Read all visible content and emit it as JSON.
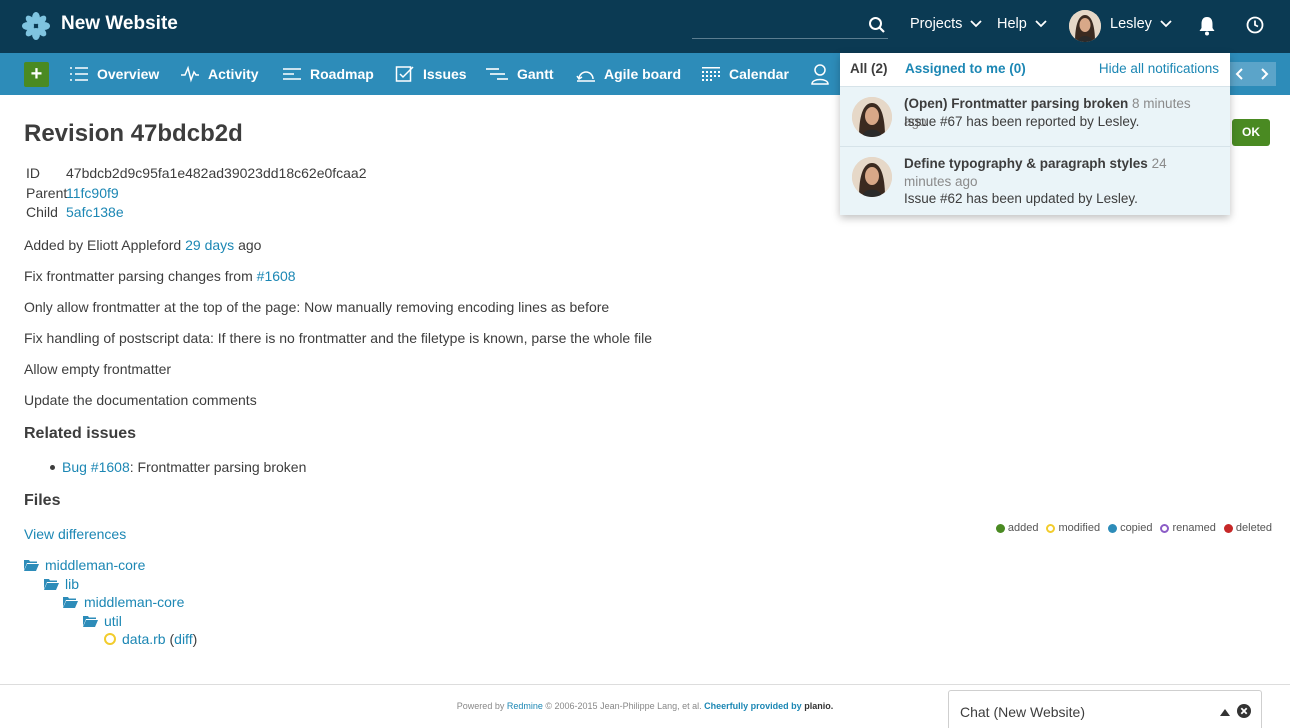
{
  "header": {
    "site_title": "New Website",
    "search_placeholder": "",
    "projects_label": "Projects",
    "help_label": "Help",
    "user_name": "Lesley"
  },
  "menu": {
    "add_label": "+",
    "items": [
      {
        "label": "Overview",
        "icon": "list-icon"
      },
      {
        "label": "Activity",
        "icon": "activity-icon"
      },
      {
        "label": "Roadmap",
        "icon": "roadmap-icon"
      },
      {
        "label": "Issues",
        "icon": "checkbox-icon"
      },
      {
        "label": "Gantt",
        "icon": "gantt-icon"
      },
      {
        "label": "Agile board",
        "icon": "agile-icon"
      },
      {
        "label": "Calendar",
        "icon": "calendar-icon"
      }
    ]
  },
  "revision": {
    "title": "Revision 47bdcb2d",
    "ok_label": "OK",
    "id_label": "ID",
    "id_value": "47bdcb2d9c95fa1e482ad39023dd18c62e0fcaa2",
    "parent_label": "Parent",
    "parent_value": "11fc90f9",
    "child_label": "Child",
    "child_value": "5afc138e",
    "added_by_prefix": "Added by Eliott Appleford",
    "added_by_link": "29 days",
    "added_by_suffix": "ago",
    "message_line1_prefix": "Fix frontmatter parsing changes from",
    "message_line1_link": "#1608",
    "message_line2": "Only allow frontmatter at the top of the page: Now manually removing encoding lines as before",
    "message_line3": "Fix handling of postscript data: If there is no frontmatter and the filetype is known, parse the whole file",
    "message_line4": "Allow empty frontmatter",
    "message_line5": "Update the documentation comments"
  },
  "related": {
    "heading": "Related issues",
    "issue_link": "Bug #1608",
    "issue_text": ": Frontmatter parsing broken"
  },
  "files": {
    "heading": "Files",
    "view_diff": "View differences",
    "legend": [
      {
        "label": "added",
        "color": "#4a8a22"
      },
      {
        "label": "modified",
        "color": "#f2cc2c"
      },
      {
        "label": "copied",
        "color": "#2d8cb9"
      },
      {
        "label": "renamed",
        "color": "#8b5cc6"
      },
      {
        "label": "deleted",
        "color": "#c62828"
      }
    ],
    "tree": [
      "middleman-core",
      "lib",
      "middleman-core",
      "util"
    ],
    "file_name": "data.rb",
    "diff_open": " (",
    "diff_link": "diff",
    "diff_close": ")"
  },
  "footer": {
    "powered_prefix": "Powered by",
    "redmine": "Redmine",
    "copyright": "© 2006-2015 Jean-Philippe Lang, et al.",
    "provided": "Cheerfully provided by",
    "brand": "planio."
  },
  "chat": {
    "title": "Chat (New Website)"
  },
  "notifications": {
    "tab_all": "All (2)",
    "tab_assigned": "Assigned to me (0)",
    "hide_all": "Hide all notifications",
    "items": [
      {
        "title": "(Open) Frontmatter parsing broken",
        "time": "8 minutes ago",
        "desc": "Issue #67 has been reported by Lesley."
      },
      {
        "title": "Define typography & paragraph styles",
        "time": "24 minutes ago",
        "desc": "Issue #62 has been updated by Lesley."
      }
    ]
  }
}
